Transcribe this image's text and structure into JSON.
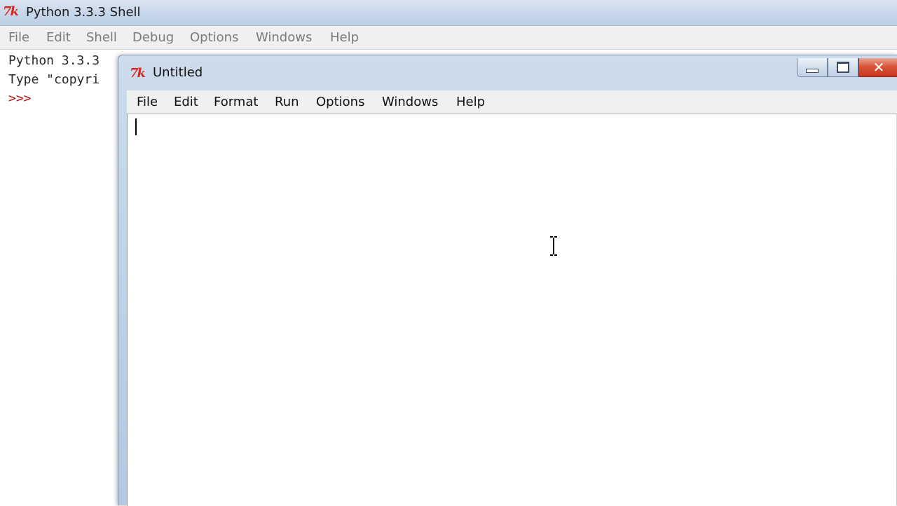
{
  "shell": {
    "title": "Python 3.3.3 Shell",
    "menu": [
      "File",
      "Edit",
      "Shell",
      "Debug",
      "Options",
      "Windows",
      "Help"
    ],
    "lines": [
      "Python 3.3.3",
      "Type \"copyri"
    ],
    "prompt": ">>>"
  },
  "editor": {
    "title": "Untitled",
    "menu": [
      "File",
      "Edit",
      "Format",
      "Run",
      "Options",
      "Windows",
      "Help"
    ],
    "content": ""
  },
  "icons": {
    "app_logo": "tk-feather-icon",
    "window_controls": [
      "minimize-icon",
      "maximize-icon",
      "close-icon"
    ],
    "mouse_cursor": "text-ibeam-cursor"
  },
  "colors": {
    "titlebar": "#c9d8ea",
    "menubar": "#f0f0f0",
    "prompt": "#b01010",
    "close_button": "#d9563b",
    "logo": "#d8261f"
  }
}
